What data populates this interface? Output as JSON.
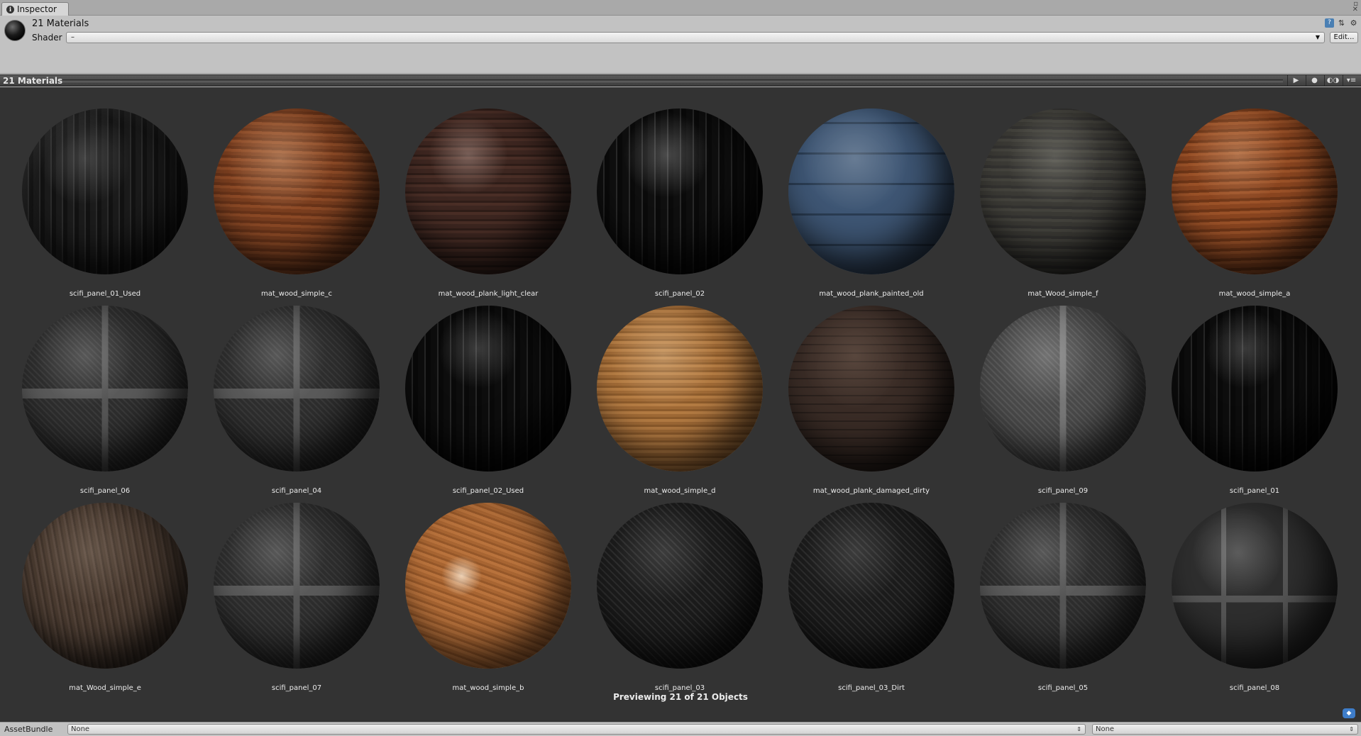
{
  "tab": {
    "label": "Inspector",
    "icon": "info-icon"
  },
  "window_controls": [
    "▫",
    "✕"
  ],
  "header": {
    "title": "21 Materials",
    "shader_label": "Shader",
    "shader_value": "–",
    "edit_label": "Edit..."
  },
  "preview_bar": {
    "title": "21 Materials",
    "buttons": [
      "▶",
      "●",
      "◐◑",
      "▾≡"
    ]
  },
  "materials": [
    {
      "name": "scifi_panel_01_Used",
      "material": "s-scifi01u"
    },
    {
      "name": "mat_wood_simple_c",
      "material": "s-woodc"
    },
    {
      "name": "mat_wood_plank_light_clear",
      "material": "s-woodplank"
    },
    {
      "name": "scifi_panel_02",
      "material": "s-scifi02"
    },
    {
      "name": "mat_wood_plank_painted_old",
      "material": "s-painted"
    },
    {
      "name": "mat_Wood_simple_f",
      "material": "s-woodf"
    },
    {
      "name": "mat_wood_simple_a",
      "material": "s-wooda"
    },
    {
      "name": "scifi_panel_06",
      "material": "s-panelgrey"
    },
    {
      "name": "scifi_panel_04",
      "material": "s-panelgrey"
    },
    {
      "name": "scifi_panel_02_Used",
      "material": "s-scifi01"
    },
    {
      "name": "mat_wood_simple_d",
      "material": "s-woodd"
    },
    {
      "name": "mat_wood_plank_damaged_dirty",
      "material": "s-damaged"
    },
    {
      "name": "scifi_panel_09",
      "material": "s-scifi09"
    },
    {
      "name": "scifi_panel_01",
      "material": "s-scifi01"
    },
    {
      "name": "mat_Wood_simple_e",
      "material": "s-woode"
    },
    {
      "name": "scifi_panel_07",
      "material": "s-panelgrey"
    },
    {
      "name": "mat_wood_simple_b",
      "material": "s-woodb"
    },
    {
      "name": "scifi_panel_03",
      "material": "s-plate"
    },
    {
      "name": "scifi_panel_03_Dirt",
      "material": "s-plate"
    },
    {
      "name": "scifi_panel_05",
      "material": "s-panelgrey"
    },
    {
      "name": "scifi_panel_08",
      "material": "s-scifi08"
    }
  ],
  "status": "Previewing 21 of 21 Objects",
  "asset_bundle": {
    "label": "AssetBundle",
    "name_value": "None",
    "variant_value": "None"
  }
}
